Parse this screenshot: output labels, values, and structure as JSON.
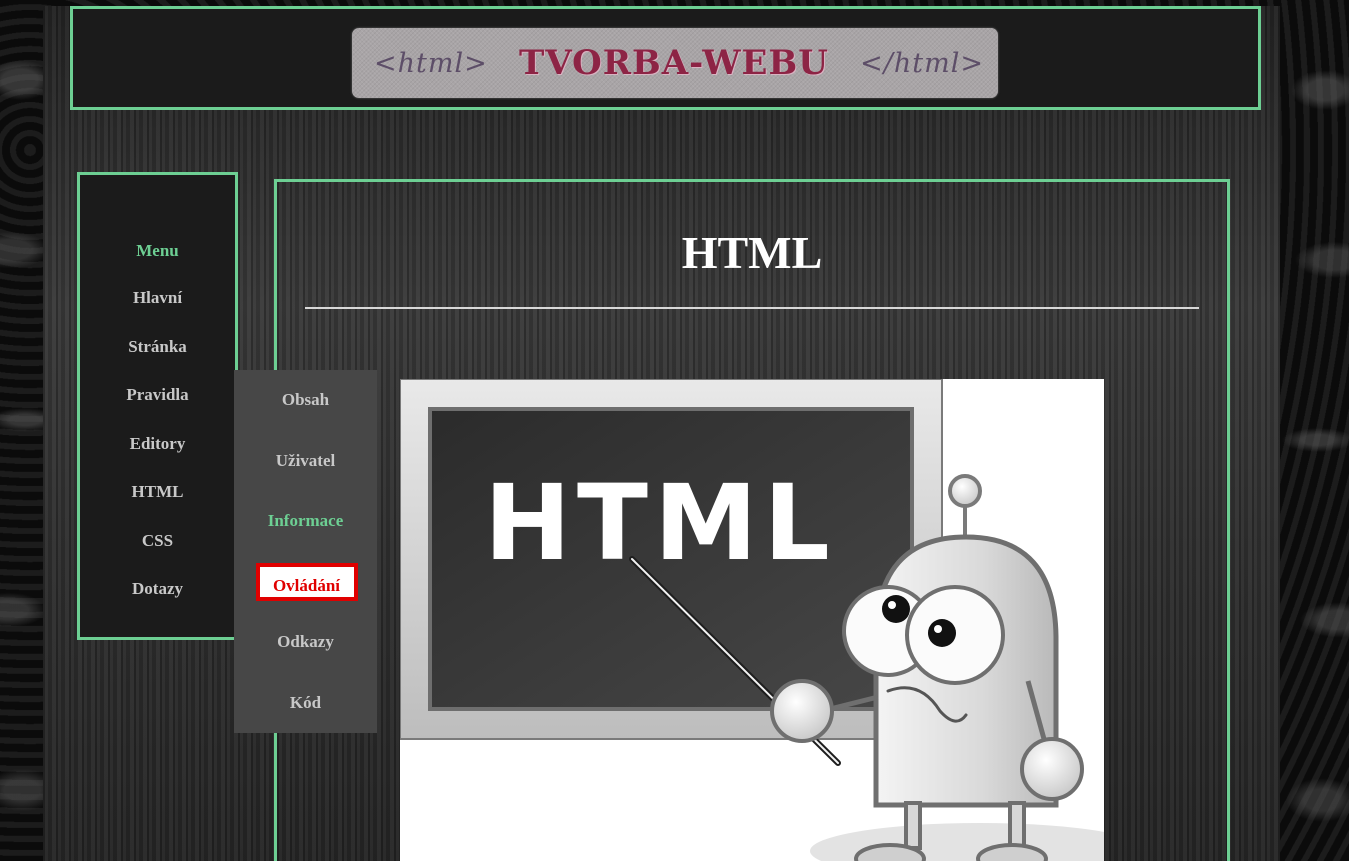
{
  "header": {
    "logo_left_tag": "<html>",
    "logo_title": "TVORBA-WEBU",
    "logo_right_tag": "</html>"
  },
  "sidebar": {
    "title": "Menu",
    "items": [
      {
        "label": "Hlavní"
      },
      {
        "label": "Stránka"
      },
      {
        "label": "Pravidla"
      },
      {
        "label": "Editory"
      },
      {
        "label": "HTML"
      },
      {
        "label": "CSS"
      },
      {
        "label": "Dotazy"
      }
    ]
  },
  "submenu": {
    "items": [
      {
        "label": "Obsah"
      },
      {
        "label": "Uživatel"
      },
      {
        "label": "Informace"
      },
      {
        "label": "Ovládání"
      },
      {
        "label": "Odkazy"
      },
      {
        "label": "Kód"
      }
    ]
  },
  "content": {
    "title": "HTML",
    "image": {
      "board_text": "HTML"
    }
  },
  "colors": {
    "accent_green": "#6dcf93",
    "highlight_red": "#e00000",
    "panel_dark": "#1b1b1b",
    "submenu_bg": "#474747"
  }
}
